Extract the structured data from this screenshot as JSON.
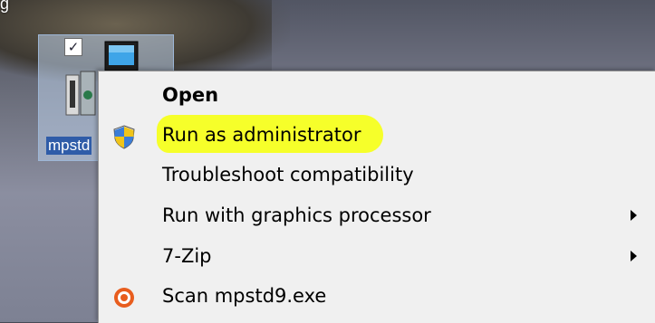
{
  "desktop": {
    "icon_label": "mpstd",
    "checkbox_mark": "✓",
    "top_partial_text": "g"
  },
  "context_menu": {
    "items": [
      {
        "label": "Open",
        "bold": true,
        "icon": "",
        "submenu": false
      },
      {
        "label": "Run as administrator",
        "bold": false,
        "icon": "uac-shield-icon",
        "submenu": false,
        "highlighted": true
      },
      {
        "label": "Troubleshoot compatibility",
        "bold": false,
        "icon": "",
        "submenu": false
      },
      {
        "label": "Run with graphics processor",
        "bold": false,
        "icon": "",
        "submenu": true
      },
      {
        "label": "7-Zip",
        "bold": false,
        "icon": "",
        "submenu": true
      },
      {
        "label": "Scan mpstd9.exe",
        "bold": false,
        "icon": "antivirus-icon",
        "submenu": false
      }
    ]
  },
  "colors": {
    "highlight": "#f6ff2a",
    "menu_bg": "#f0f0f0",
    "selection": "#2f5ca8"
  }
}
